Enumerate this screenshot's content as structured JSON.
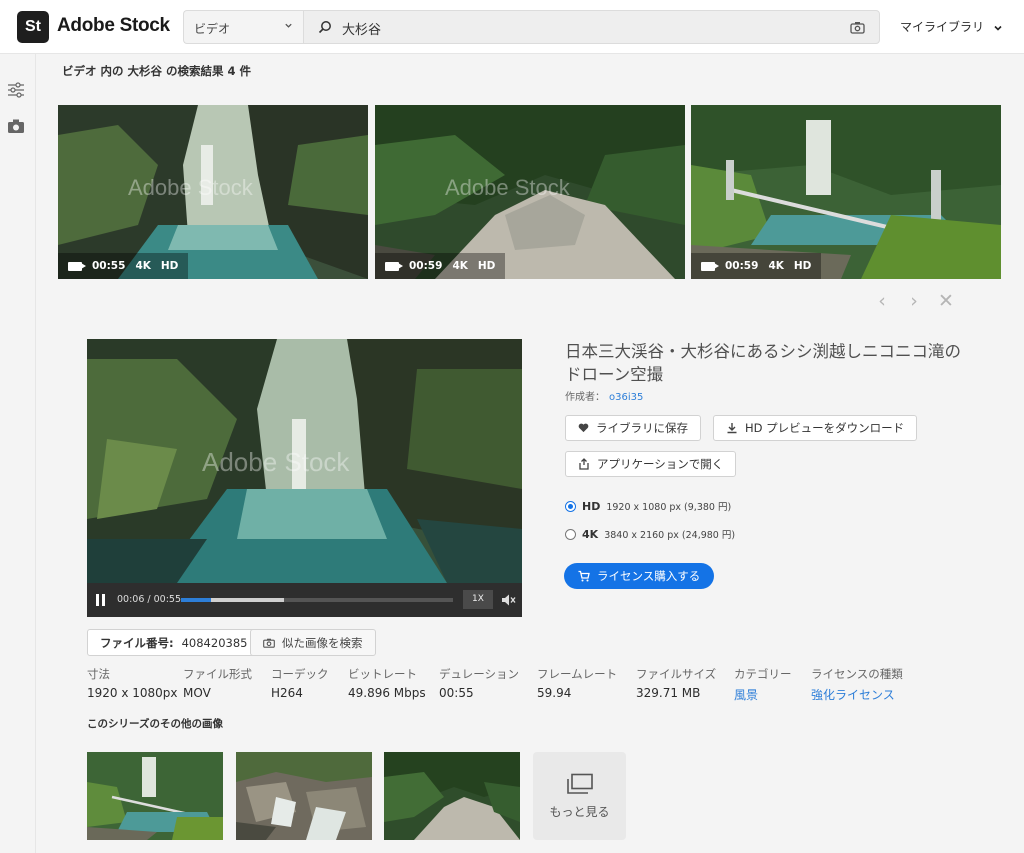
{
  "header": {
    "logo_mark": "St",
    "logo_text": "Adobe Stock",
    "category": "ビデオ",
    "search_value": "大杉谷",
    "my_library": "マイライブラリ"
  },
  "results": {
    "title": "ビデオ 内の 大杉谷 の検索結果 4 件",
    "thumbnails": [
      {
        "duration": "00:55",
        "quality": "4K",
        "hd": "HD",
        "watermark": "Adobe Stock"
      },
      {
        "duration": "00:59",
        "quality": "4K",
        "hd": "HD",
        "watermark": "Adobe Stock"
      },
      {
        "duration": "00:59",
        "quality": "4K",
        "hd": "HD"
      }
    ],
    "nav": {
      "prev": "‹",
      "next": "›",
      "close": "✕"
    }
  },
  "player": {
    "watermark": "Adobe Stock",
    "timecode": "00:06 / 00:55",
    "speed": "1X",
    "played_fraction": 0.11,
    "buffered_fraction": 0.38
  },
  "detail": {
    "title": "日本三大渓谷・大杉谷にあるシシ渕越しニコニコ滝のドローン空撮",
    "author_label": "作成者：",
    "author_name": "o36i35",
    "save_label": "ライブラリに保存",
    "download_label": "HD プレビューをダウンロード",
    "open_app_label": "アプリケーションで開く",
    "licenses": [
      {
        "name": "HD",
        "spec": "1920 x 1080 px (9,380 円)",
        "selected": true
      },
      {
        "name": "4K",
        "spec": "3840 x 2160 px (24,980 円)",
        "selected": false
      }
    ],
    "buy_label": "ライセンス購入する"
  },
  "file": {
    "number_label": "ファイル番号:",
    "number": "408420385",
    "similar_label": "似た画像を検索",
    "specs": [
      {
        "key": "寸法",
        "value": "1920 x 1080px"
      },
      {
        "key": "ファイル形式",
        "value": "MOV"
      },
      {
        "key": "コーデック",
        "value": "H264"
      },
      {
        "key": "ビットレート",
        "value": "49.896 Mbps"
      },
      {
        "key": "デュレーション",
        "value": "00:55"
      },
      {
        "key": "フレームレート",
        "value": "59.94"
      },
      {
        "key": "ファイルサイズ",
        "value": "329.71 MB"
      },
      {
        "key": "カテゴリー",
        "value": "風景"
      },
      {
        "key": "ライセンスの種類",
        "value": "強化ライセンス"
      }
    ]
  },
  "series": {
    "title": "このシリーズのその他の画像",
    "more_label": "もっと見る"
  },
  "colors": {
    "accent": "#1473e6",
    "link": "#2d7ed8",
    "background": "#f4f4f4"
  }
}
